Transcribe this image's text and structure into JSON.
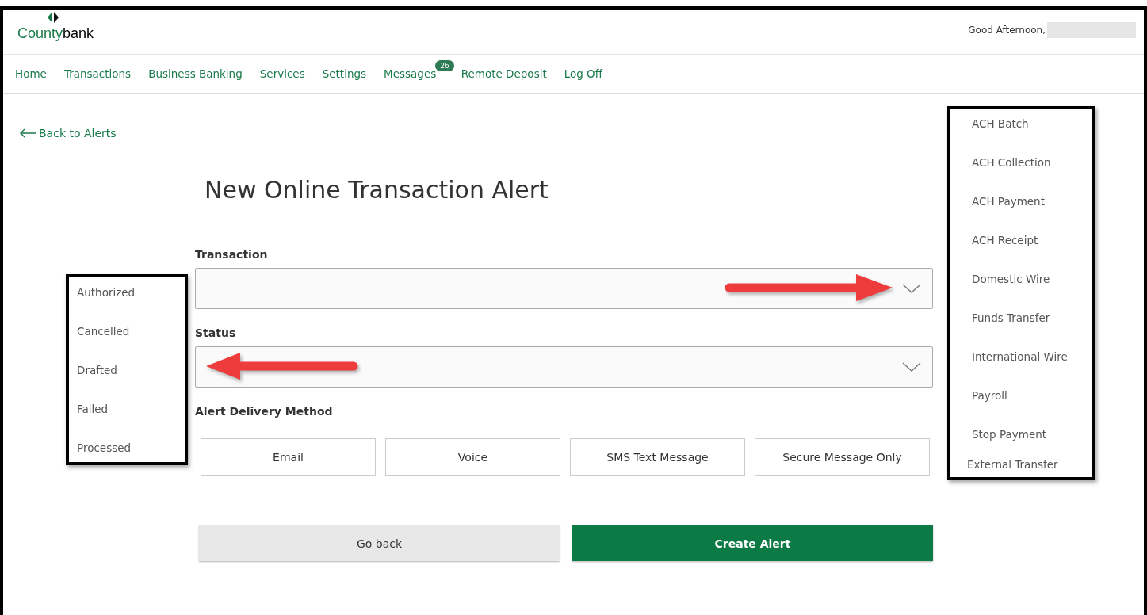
{
  "header": {
    "logo": {
      "name_part1": "County",
      "name_part2": "bank"
    },
    "greeting": "Good Afternoon,"
  },
  "nav": [
    {
      "label": "Home"
    },
    {
      "label": "Transactions"
    },
    {
      "label": "Business Banking"
    },
    {
      "label": "Services"
    },
    {
      "label": "Settings"
    },
    {
      "label": "Messages",
      "badge": "26"
    },
    {
      "label": "Remote Deposit"
    },
    {
      "label": "Log Off"
    }
  ],
  "back_link": "Back to Alerts",
  "status_options": [
    "Authorized",
    "Cancelled",
    "Drafted",
    "Failed",
    "Processed"
  ],
  "form": {
    "title": "New Online Transaction Alert",
    "fields": [
      {
        "label": "Transaction"
      },
      {
        "label": "Status"
      }
    ],
    "delivery_label": "Alert Delivery Method",
    "delivery_options": [
      {
        "label": "Email"
      },
      {
        "label": "Voice"
      },
      {
        "label": "SMS Text Message"
      },
      {
        "label": "Secure Message Only"
      }
    ],
    "buttons": [
      {
        "label": "Go back",
        "kind": "secondary"
      },
      {
        "label": "Create Alert",
        "kind": "primary"
      }
    ]
  },
  "transaction_options": [
    "ACH Batch",
    "ACH Collection",
    "ACH Payment",
    "ACH Receipt",
    "Domestic Wire",
    "Funds Transfer",
    "International Wire",
    "Payroll",
    "Stop Payment",
    "External Transfer"
  ]
}
